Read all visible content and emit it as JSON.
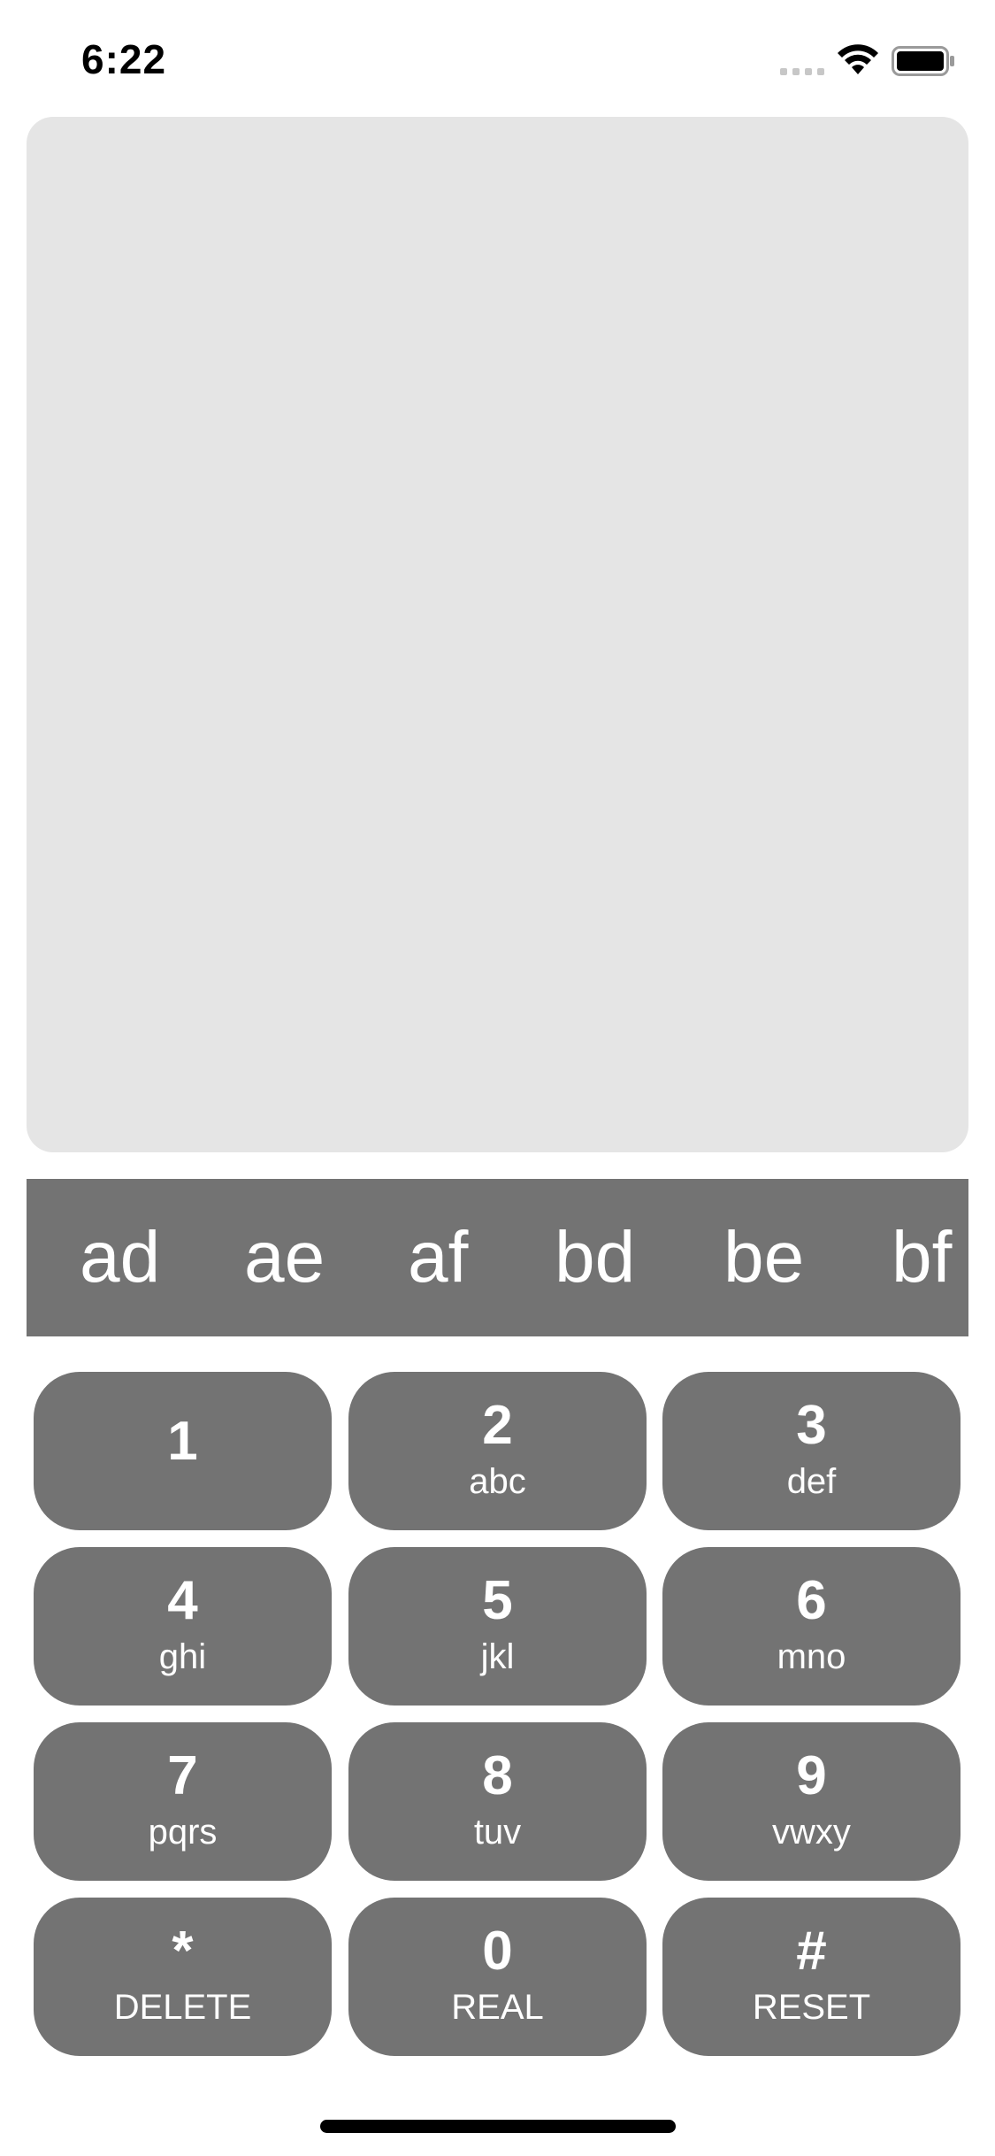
{
  "status_bar": {
    "time": "6:22"
  },
  "suggestions": [
    "ad",
    "ae",
    "af",
    "bd",
    "be",
    "bf"
  ],
  "keypad": {
    "keys": [
      {
        "digit": "1",
        "letters": ""
      },
      {
        "digit": "2",
        "letters": "abc"
      },
      {
        "digit": "3",
        "letters": "def"
      },
      {
        "digit": "4",
        "letters": "ghi"
      },
      {
        "digit": "5",
        "letters": "jkl"
      },
      {
        "digit": "6",
        "letters": "mno"
      },
      {
        "digit": "7",
        "letters": "pqrs"
      },
      {
        "digit": "8",
        "letters": "tuv"
      },
      {
        "digit": "9",
        "letters": "vwxy"
      },
      {
        "digit": "*",
        "letters": "DELETE"
      },
      {
        "digit": "0",
        "letters": "REAL"
      },
      {
        "digit": "#",
        "letters": "RESET"
      }
    ]
  },
  "colors": {
    "panel": "#e5e5e5",
    "key": "#737373",
    "text": "#ffffff"
  }
}
